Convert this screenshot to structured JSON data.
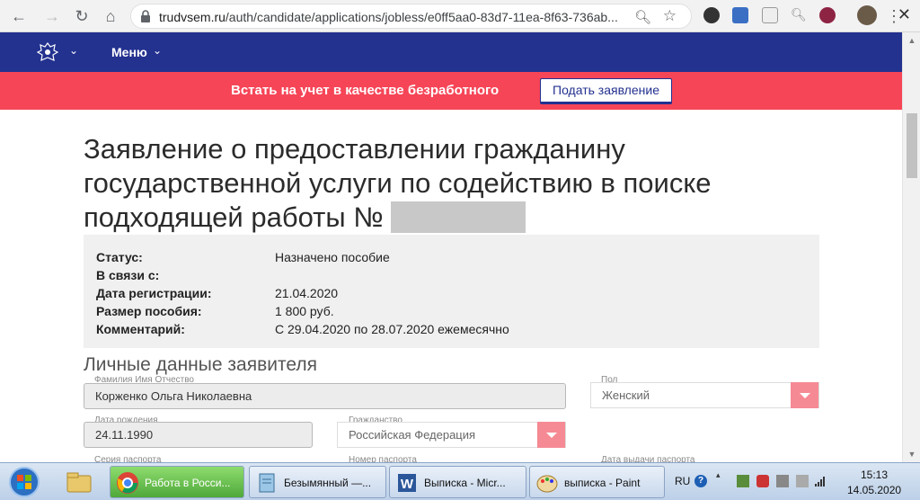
{
  "browser": {
    "url_host": "trudvsem.ru",
    "url_path": "/auth/candidate/applications/jobless/e0ff5aa0-83d7-11ea-8f63-736ab..."
  },
  "site": {
    "menu_label": "Меню"
  },
  "banner": {
    "text": "Встать на учет в качестве безработного",
    "button_label": "Подать заявление"
  },
  "page": {
    "title": "Заявление о предоставлении гражданину государственной услуги по содействию в поиске подходящей работы №"
  },
  "info": {
    "rows": [
      {
        "label": "Статус:",
        "value": "Назначено пособие"
      },
      {
        "label": "В связи с:",
        "value": ""
      },
      {
        "label": "Дата регистрации:",
        "value": "21.04.2020"
      },
      {
        "label": "Размер пособия:",
        "value": "1 800 руб."
      },
      {
        "label": "Комментарий:",
        "value": "С 29.04.2020 по 28.07.2020 ежемесячно"
      }
    ]
  },
  "personal": {
    "section_title": "Личные данные заявителя",
    "fio_label": "Фамилия Имя Отчество",
    "fio_value": "Корженко Ольга Николаевна",
    "gender_label": "Пол",
    "gender_value": "Женский",
    "birth_label": "Дата рождения",
    "birth_value": "24.11.1990",
    "citizenship_label": "Гражданство",
    "citizenship_value": "Российская Федерация",
    "passport_series_label": "Серия паспорта",
    "passport_number_label": "Номер паспорта",
    "passport_date_label": "Дата выдачи паспорта"
  },
  "taskbar": {
    "tasks": [
      {
        "label": "Работа в Росси..."
      },
      {
        "label": "Безымянный —..."
      },
      {
        "label": "Выписка - Micr..."
      },
      {
        "label": "выписка - Paint"
      }
    ],
    "lang": "RU",
    "time": "15:13",
    "date": "14.05.2020"
  },
  "colors": {
    "nav_blue": "#23318f",
    "banner_red": "#f64557",
    "caret_pink": "#f58a94"
  }
}
